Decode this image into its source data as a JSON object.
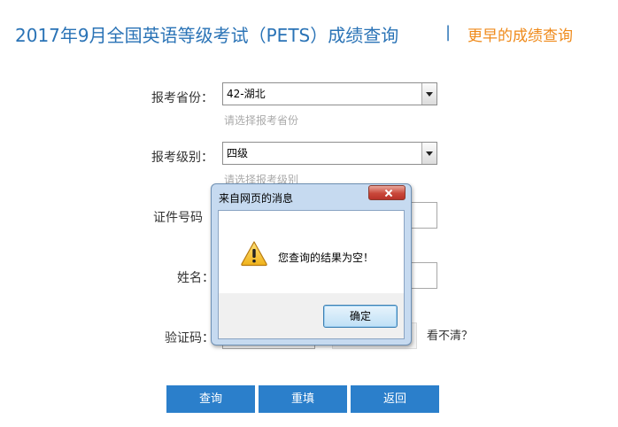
{
  "header": {
    "title": "2017年9月全国英语等级考试（PETS）成绩查询",
    "separator": "|",
    "earlier_link": "更早的成绩查询"
  },
  "form": {
    "province": {
      "label": "报考省份：",
      "value": "42-湖北",
      "hint": "请选择报考省份"
    },
    "level": {
      "label": "报考级别：",
      "value": "四级",
      "hint": "请选择报考级别"
    },
    "id_number": {
      "label": "证件号码"
    },
    "name": {
      "label": "姓名："
    },
    "captcha": {
      "label": "验证码：",
      "refresh_link": "看不清？"
    }
  },
  "buttons": {
    "query": "查询",
    "reset": "重填",
    "back": "返回"
  },
  "dialog": {
    "title": "来自网页的消息",
    "message": "您查询的结果为空！",
    "ok_label": "确定",
    "icon": "warning-icon"
  }
}
